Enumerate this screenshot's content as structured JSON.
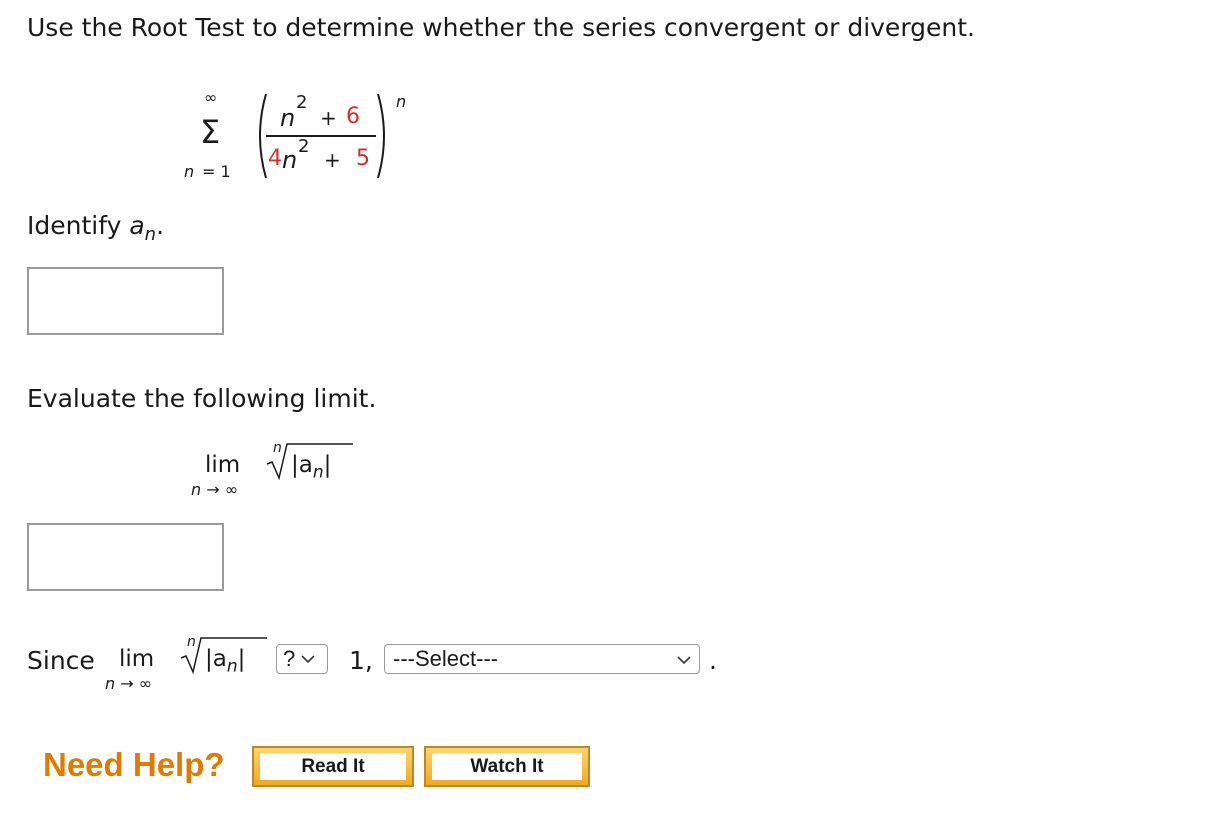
{
  "question": {
    "prompt": "Use the Root Test to determine whether the series convergent or divergent."
  },
  "series": {
    "sigma": "Σ",
    "upper": "∞",
    "lower_var": "n",
    "lower_eq": "= 1",
    "num_var": "n",
    "num_exp": "2",
    "num_op": "+",
    "num_const": "6",
    "den_coef": "4",
    "den_var": "n",
    "den_exp": "2",
    "den_op": "+",
    "den_const": "5",
    "outer_exp": "n"
  },
  "part1": {
    "label": "Identify",
    "var": "a",
    "sub": "n",
    "suffix": ".",
    "answer": ""
  },
  "part2": {
    "label": "Evaluate the following limit.",
    "lim": "lim",
    "lim_sub": "n → ∞",
    "root_index": "n",
    "radicand": "|a",
    "radicand_sub": "n",
    "radicand_end": "|",
    "answer": ""
  },
  "part3": {
    "since": "Since",
    "lim": "lim",
    "lim_sub": "n → ∞",
    "root_index": "n",
    "radicand": "|a",
    "radicand_sub": "n",
    "radicand_end": "|",
    "compare_value": "?",
    "after": "1,",
    "select_value": "---Select---",
    "end": "."
  },
  "help": {
    "label": "Need Help?",
    "read_it": "Read It",
    "watch_it": "Watch It"
  }
}
